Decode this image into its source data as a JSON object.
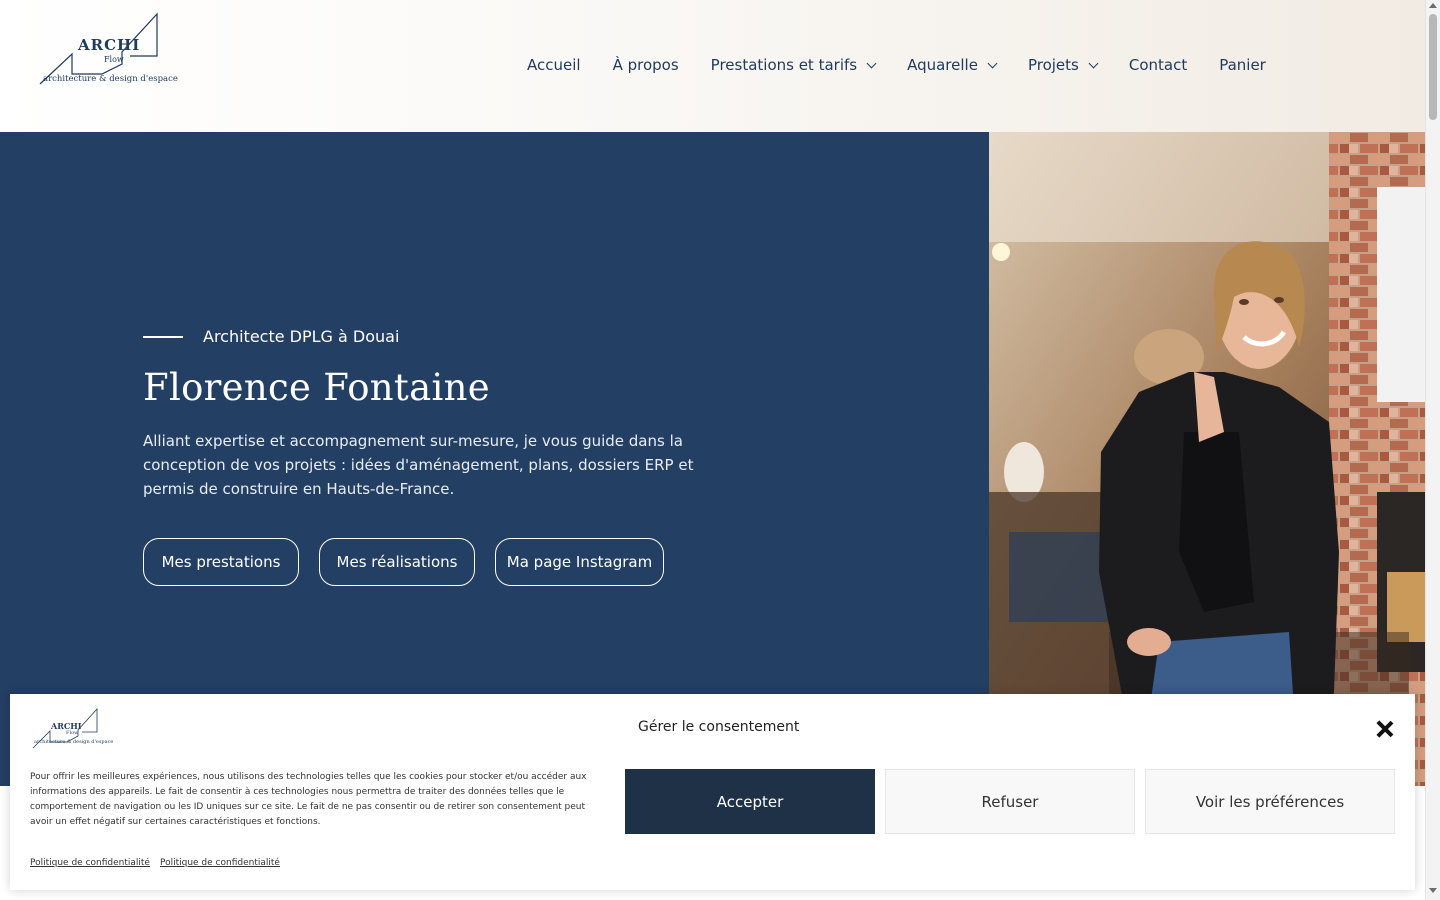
{
  "header": {
    "logo": {
      "wordmark": "ARCHI",
      "subword": "Flow",
      "tagline": "architecture & design d'espace"
    },
    "nav": [
      {
        "label": "Accueil",
        "has_dropdown": false
      },
      {
        "label": "À propos",
        "has_dropdown": false
      },
      {
        "label": "Prestations et tarifs",
        "has_dropdown": true
      },
      {
        "label": "Aquarelle",
        "has_dropdown": true
      },
      {
        "label": "Projets",
        "has_dropdown": true
      },
      {
        "label": "Contact",
        "has_dropdown": false
      },
      {
        "label": "Panier",
        "has_dropdown": false
      }
    ]
  },
  "hero": {
    "eyebrow": "Architecte DPLG à Douai",
    "title": "Florence Fontaine",
    "description": "Alliant expertise et accompagnement sur-mesure, je vous guide dans la conception de vos projets : idées d'aménagement, plans, dossiers ERP et permis de construire en Hauts-de-France.",
    "buttons": [
      "Mes prestations",
      "Mes réalisations",
      "Ma page Instagram"
    ],
    "background_color": "#243f64"
  },
  "consent": {
    "title": "Gérer le consentement",
    "text": "Pour offrir les meilleures expériences, nous utilisons des technologies telles que les cookies pour stocker et/ou accéder aux informations des appareils. Le fait de consentir à ces technologies nous permettra de traiter des données telles que le comportement de navigation ou les ID uniques sur ce site. Le fait de ne pas consentir ou de retirer son consentement peut avoir un effet négatif sur certaines caractéristiques et fonctions.",
    "accept": "Accepter",
    "refuse": "Refuser",
    "preferences": "Voir les préférences",
    "links": [
      "Politique de confidentialité",
      "Politique de confidentialité"
    ],
    "accept_color": "#1f3147"
  }
}
